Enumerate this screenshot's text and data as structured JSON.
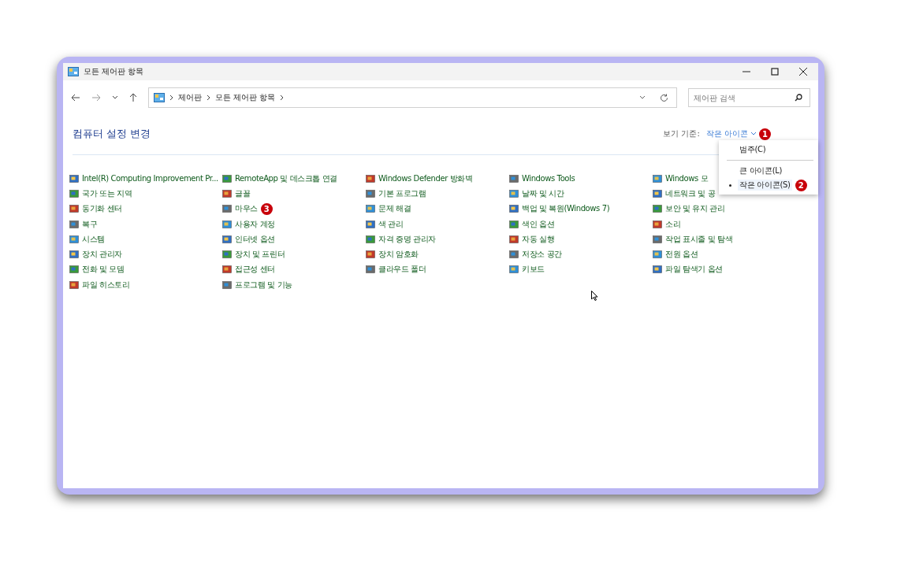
{
  "window": {
    "title": "모든 제어판 항목"
  },
  "breadcrumb": [
    "제어판",
    "모든 제어판 항목"
  ],
  "search": {
    "placeholder": "제어판 검색"
  },
  "heading": "컴퓨터 설정 변경",
  "view_by": {
    "label": "보기 기준:",
    "value": "작은 아이콘",
    "badge": "1"
  },
  "view_menu": [
    {
      "kind": "item",
      "label": "범주(C)",
      "selected": false
    },
    {
      "kind": "separator"
    },
    {
      "kind": "item",
      "label": "큰 아이콘(L)",
      "selected": false
    },
    {
      "kind": "item",
      "label": "작은 아이콘(S)",
      "selected": true,
      "badge": "2"
    }
  ],
  "columns": [
    [
      {
        "label": "Intel(R) Computing Improvement Pr..."
      },
      {
        "label": "국가 또는 지역"
      },
      {
        "label": "동기화 센터"
      },
      {
        "label": "복구"
      },
      {
        "label": "시스템"
      },
      {
        "label": "장치 관리자"
      },
      {
        "label": "전화 및 모뎀"
      },
      {
        "label": "파일 히스토리"
      }
    ],
    [
      {
        "label": "RemoteApp 및 데스크톱 연결"
      },
      {
        "label": "글꼴"
      },
      {
        "label": "마우스",
        "badge": "3"
      },
      {
        "label": "사용자 계정"
      },
      {
        "label": "인터넷 옵션"
      },
      {
        "label": "장치 및 프린터"
      },
      {
        "label": "접근성 센터"
      },
      {
        "label": "프로그램 및 기능"
      }
    ],
    [
      {
        "label": "Windows Defender 방화벽"
      },
      {
        "label": "기본 프로그램"
      },
      {
        "label": "문제 해결"
      },
      {
        "label": "색 관리"
      },
      {
        "label": "자격 증명 관리자"
      },
      {
        "label": "장치 암호화"
      },
      {
        "label": "클라우드 폴더"
      }
    ],
    [
      {
        "label": "Windows Tools"
      },
      {
        "label": "날짜 및 시간"
      },
      {
        "label": "백업 및 복원(Windows 7)"
      },
      {
        "label": "색인 옵션"
      },
      {
        "label": "자동 실행"
      },
      {
        "label": "저장소 공간"
      },
      {
        "label": "키보드"
      }
    ],
    [
      {
        "label": "Windows 모"
      },
      {
        "label": "네트워크 및 공"
      },
      {
        "label": "보안 및 유지 관리"
      },
      {
        "label": "소리"
      },
      {
        "label": "작업 표시줄 및 탐색"
      },
      {
        "label": "전원 옵션"
      },
      {
        "label": "파일 탐색기 옵션"
      }
    ]
  ]
}
